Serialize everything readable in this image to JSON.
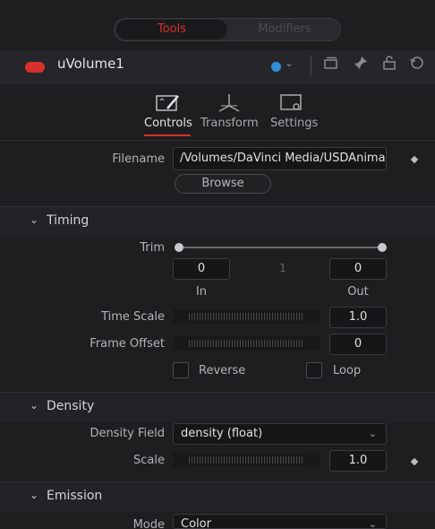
{
  "panel_tabs": {
    "tools": "Tools",
    "modifiers": "Modifiers"
  },
  "node": {
    "name": "uVolume1",
    "color_dot": "#d8312c",
    "swatch": "#2e8fd6"
  },
  "header_icons": [
    "chevron-down-icon",
    "versions-icon",
    "pin-icon",
    "lock-icon",
    "reset-icon"
  ],
  "inspector_tabs": [
    {
      "label": "Controls",
      "icon": "controls-icon",
      "active": true
    },
    {
      "label": "Transform",
      "icon": "transform-icon",
      "active": false
    },
    {
      "label": "Settings",
      "icon": "settings-icon",
      "active": false
    }
  ],
  "filename": {
    "label": "Filename",
    "value": "/Volumes/DaVinci Media/USDAnima",
    "browse": "Browse"
  },
  "timing": {
    "title": "Timing",
    "trim_label": "Trim",
    "trim_in": "0",
    "trim_mid": "1",
    "trim_out": "0",
    "in_label": "In",
    "out_label": "Out",
    "time_scale_label": "Time Scale",
    "time_scale_value": "1.0",
    "frame_offset_label": "Frame Offset",
    "frame_offset_value": "0",
    "reverse_label": "Reverse",
    "loop_label": "Loop",
    "reverse_checked": false,
    "loop_checked": false
  },
  "density": {
    "title": "Density",
    "field_label": "Density Field",
    "field_value": "density (float)",
    "scale_label": "Scale",
    "scale_value": "1.0"
  },
  "emission": {
    "title": "Emission",
    "mode_label": "Mode",
    "mode_value": "Color"
  },
  "colors": {
    "accent": "#d8312c",
    "background": "#1e1e21"
  }
}
